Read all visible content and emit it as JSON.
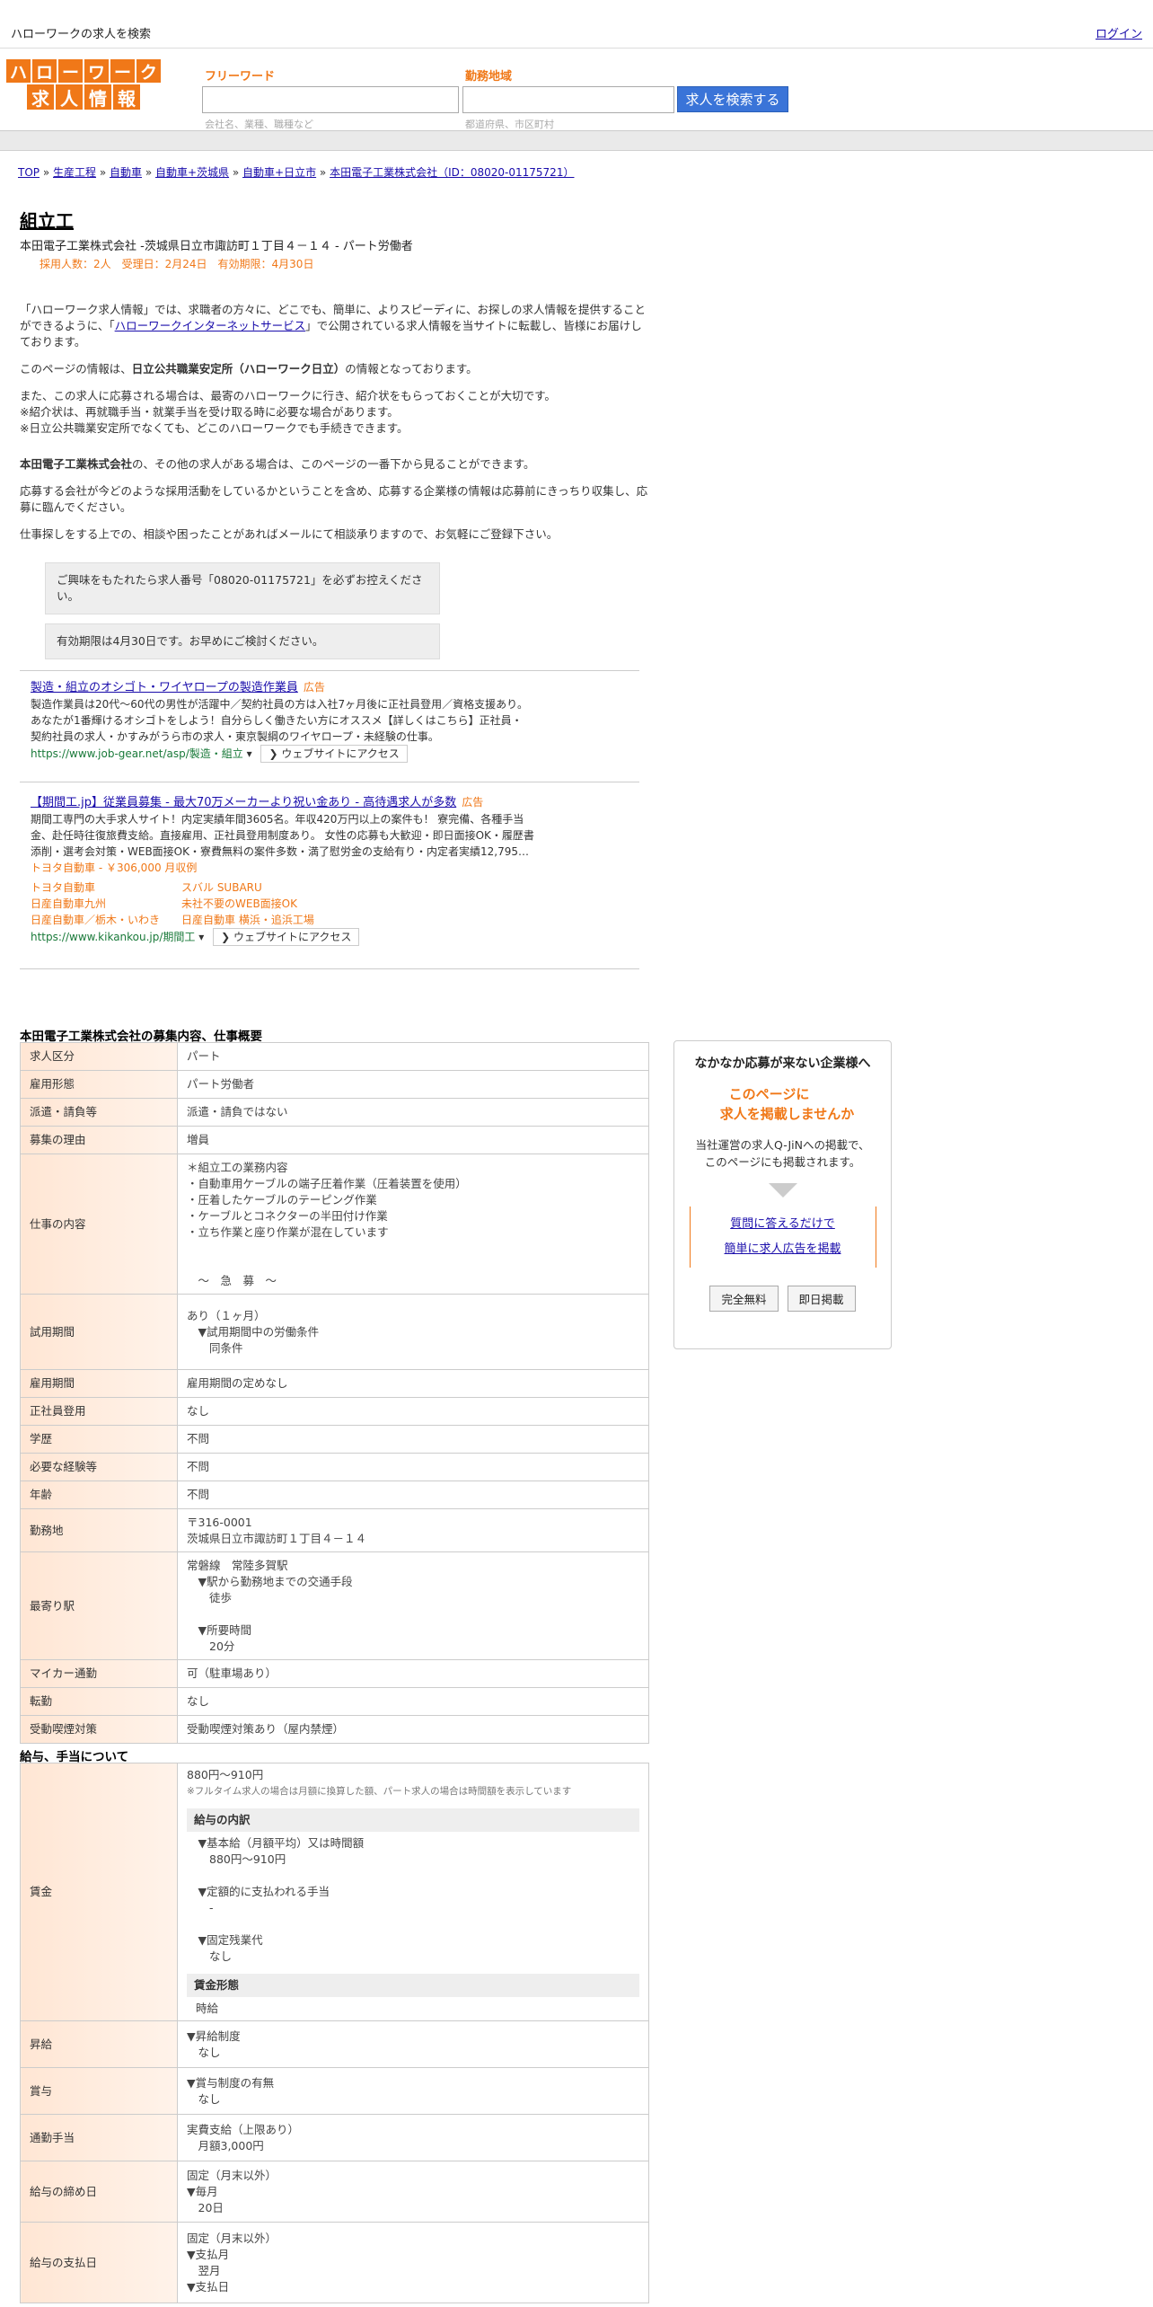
{
  "topbar": {
    "title": "ハローワークの求人を検索",
    "login": "ログイン"
  },
  "logo": {
    "row1": [
      "ハ",
      "ロ",
      "ー",
      "ワ",
      "ー",
      "ク"
    ],
    "row2": [
      "求",
      "人",
      "情",
      "報"
    ]
  },
  "search": {
    "free_label": "フリーワード",
    "free_hint": "会社名、業種、職種など",
    "area_label": "勤務地域",
    "area_hint": "都道府県、市区町村",
    "button": "求人を検索する"
  },
  "breadcrumb": [
    "TOP",
    "生産工程",
    "自動車",
    "自動車+茨城県",
    "自動車+日立市",
    "本田電子工業株式会社（ID：08020-01175721）"
  ],
  "job": {
    "title": "組立工",
    "company": "本田電子工業株式会社 -茨城県日立市諏訪町１丁目４－１４ - パート労働者",
    "meta": "採用人数：2人　受理日：2月24日　有効期限：4月30日"
  },
  "intro": {
    "p1a": "「ハローワーク求人情報」では、求職者の方々に、どこでも、簡単に、よりスピーディに、お探しの求人情報を提供することができるように、「",
    "p1link": "ハローワークインターネットサービス",
    "p1b": "」で公開されている求人情報を当サイトに転載し、皆様にお届けしております。",
    "p2a": "このページの情報は、",
    "p2b": "日立公共職業安定所（ハローワーク日立）",
    "p2c": "の情報となっております。",
    "p3": "また、この求人に応募される場合は、最寄のハローワークに行き、紹介状をもらっておくことが大切です。",
    "p4": "※紹介状は、再就職手当・就業手当を受け取る時に必要な場合があります。",
    "p5": "※日立公共職業安定所でなくても、どこのハローワークでも手続きできます。",
    "p6a": "本田電子工業株式会社",
    "p6b": "の、その他の求人がある場合は、このページの一番下から見ることができます。",
    "p7": "応募する会社が今どのような採用活動をしているかということを含め、応募する企業様の情報は応募前にきっちり収集し、応募に臨んでください。",
    "p8": "仕事探しをする上での、相談や困ったことがあればメールにて相談承りますので、お気軽にご登録下さい。",
    "box1": "ご興味をもたれたら求人番号「08020-01175721」を必ずお控えください。",
    "box2": "有効期限は4月30日です。お早めにご検討ください。"
  },
  "ads": [
    {
      "title": "製造・組立のオシゴト・ワイヤロープの製造作業員",
      "tag": "広告",
      "lines": [
        "製造作業員は20代～60代の男性が活躍中／契約社員の方は入社7ヶ月後に正社員登用／資格支援あり。",
        "あなたが1番輝けるオシゴトをしよう！自分らしく働きたい方にオススメ【詳しくはこちら】正社員・",
        "契約社員の求人・かすみがうら市の求人・東京製綱のワイヤロープ・未経験の仕事。"
      ],
      "url": "https://www.job-gear.net/asp/製造・組立",
      "visit": "❯ ウェブサイトにアクセス"
    },
    {
      "title": "【期間工.jp】従業員募集 - 最大70万メーカーより祝い金あり - 高待遇求人が多数",
      "tag": "広告",
      "lines": [
        "期間工専門の大手求人サイト！内定実績年間3605名。年収420万円以上の案件も！ 寮完備、各種手当",
        "金、赴任時往復旅費支給。直接雇用、正社員登用制度あり。 女性の応募も大歓迎・即日面接OK・履歴書",
        "添削・選考会対策・WEB面接OK・寮費無料の案件多数・満了慰労金の支給有り・内定者実績12,795…"
      ],
      "extra": "トヨタ自動車 - ￥306,000 月収例",
      "links": [
        [
          "トヨタ自動車",
          "スバル SUBARU"
        ],
        [
          "日産自動車九州",
          "未社不要のWEB面接OK"
        ],
        [
          "日産自動車／栃木・いわき",
          "日産自動車 横浜・追浜工場"
        ]
      ],
      "url": "https://www.kikankou.jp/期間工",
      "visit": "❯ ウェブサイトにアクセス"
    }
  ],
  "section1": "本田電子工業株式会社の募集内容、仕事概要",
  "rows1": [
    {
      "k": "求人区分",
      "v": [
        "パート"
      ]
    },
    {
      "k": "雇用形態",
      "v": [
        "パート労働者"
      ]
    },
    {
      "k": "派遣・請負等",
      "v": [
        "派遣・請負ではない"
      ]
    },
    {
      "k": "募集の理由",
      "v": [
        "増員"
      ]
    },
    {
      "k": "仕事の内容",
      "v": [
        "＊組立工の業務内容",
        "・自動車用ケーブルの端子圧着作業（圧着装置を使用）",
        "・圧着したケーブルのテーピング作業",
        "・ケーブルとコネクターの半田付け作業",
        "・立ち作業と座り作業が混在しています",
        "",
        "",
        "　～　急　募　～"
      ]
    },
    {
      "k": "試用期間",
      "v": [
        "あり（１ヶ月）",
        "　▼試用期間中の労働条件",
        "　　同条件"
      ]
    },
    {
      "k": "雇用期間",
      "v": [
        "雇用期間の定めなし"
      ]
    },
    {
      "k": "正社員登用",
      "v": [
        "なし"
      ]
    },
    {
      "k": "学歴",
      "v": [
        "不問"
      ]
    },
    {
      "k": "必要な経験等",
      "v": [
        "不問"
      ]
    },
    {
      "k": "年齢",
      "v": [
        "不問"
      ]
    },
    {
      "k": "勤務地",
      "v": [
        "〒316-0001",
        "茨城県日立市諏訪町１丁目４－１４"
      ]
    },
    {
      "k": "最寄り駅",
      "v": [
        "常磐線　常陸多賀駅",
        "　▼駅から勤務地までの交通手段",
        "　　徒歩",
        "",
        "　▼所要時間",
        "　　20分"
      ]
    },
    {
      "k": "マイカー通勤",
      "v": [
        "可（駐車場あり）"
      ]
    },
    {
      "k": "転勤",
      "v": [
        "なし"
      ]
    },
    {
      "k": "受動喫煙対策",
      "v": [
        "受動喫煙対策あり（屋内禁煙）"
      ]
    }
  ],
  "section2": "給与、手当について",
  "wage": {
    "k": "賃金",
    "range": "880円〜910円",
    "note": "※フルタイム求人の場合は月額に換算した額、パート求人の場合は時間額を表示しています",
    "sub1": "給与の内訳",
    "items": [
      "　▼基本給（月額平均）又は時間額",
      "　　880円〜910円",
      "",
      "　▼定額的に支払われる手当",
      "　　-",
      "",
      "　▼固定残業代",
      "　　なし"
    ],
    "sub2": "賃金形態",
    "form": "時給"
  },
  "rows2": [
    {
      "k": "昇給",
      "v": [
        "▼昇給制度",
        "　なし"
      ]
    },
    {
      "k": "賞与",
      "v": [
        "▼賞与制度の有無",
        "　なし"
      ]
    },
    {
      "k": "通勤手当",
      "v": [
        "実費支給（上限あり）",
        "　月額3,000円"
      ]
    },
    {
      "k": "給与の締め日",
      "v": [
        "固定（月末以外）",
        "▼毎月",
        "　20日"
      ]
    },
    {
      "k": "給与の支払日",
      "v": [
        "固定（月末以外）",
        "▼支払月",
        "　翌月",
        "▼支払日"
      ]
    }
  ],
  "side": {
    "heading": "なかなか応募が来ない企業様へ",
    "orange1": "このページに",
    "orange2": "求人を掲載しませんか",
    "desc1": "当社運営の求人Q-JiNへの掲載で、",
    "desc2": "このページにも掲載されます。",
    "link1": "質問に答えるだけで",
    "link2": "簡単に求人広告を掲載",
    "btn1": "完全無料",
    "btn2": "即日掲載"
  }
}
